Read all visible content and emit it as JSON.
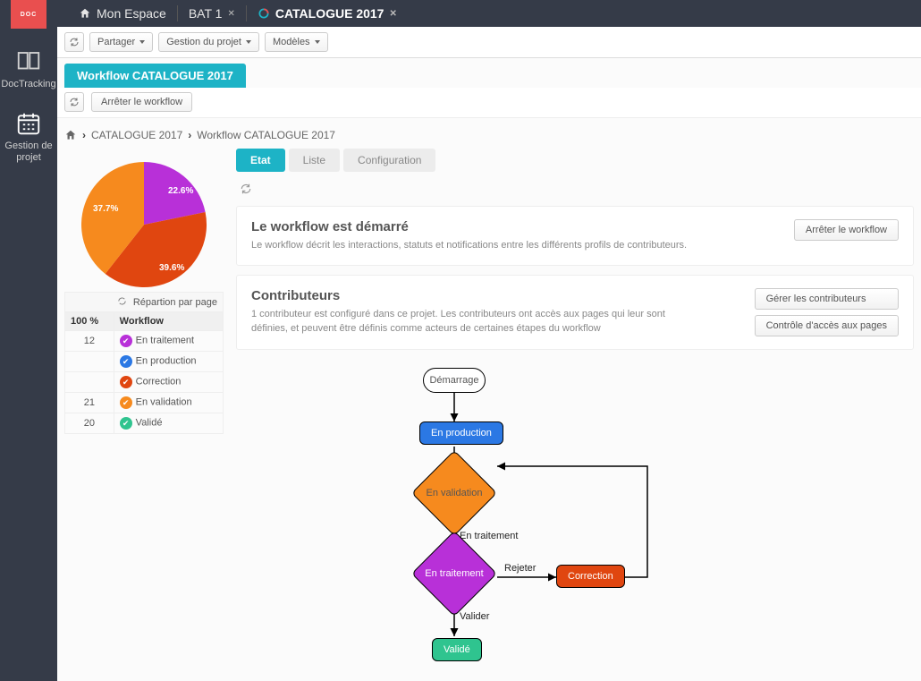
{
  "brand": "DOC\\nTRACKING",
  "rail": {
    "doctracking": "DocTracking",
    "gestion": "Gestion de projet"
  },
  "topbar": {
    "home": "Mon Espace",
    "tab1": "BAT 1",
    "tab2": "CATALOGUE 2017"
  },
  "subbar": {
    "share": "Partager",
    "project": "Gestion du projet",
    "models": "Modèles"
  },
  "workflow_tab": "Workflow CATALOGUE 2017",
  "stop_workflow": "Arrêter le workflow",
  "breadcrumb": {
    "a": "CATALOGUE 2017",
    "b": "Workflow CATALOGUE 2017"
  },
  "chart_data": {
    "type": "pie",
    "title": "",
    "slices": [
      {
        "label": "37.7%",
        "value": 37.7,
        "color": "#f68a1e"
      },
      {
        "label": "22.6%",
        "value": 22.6,
        "color": "#b830d8"
      },
      {
        "label": "39.6%",
        "value": 39.6,
        "color": "#e04610"
      }
    ]
  },
  "side_table": {
    "h1": "100 %",
    "h2": "Workflow",
    "repartition": "Répartion par page",
    "rows": [
      {
        "count": "12",
        "color": "#b830d8",
        "label": "En traitement"
      },
      {
        "count": "",
        "color": "#2b78e4",
        "label": "En production"
      },
      {
        "count": "",
        "color": "#e04610",
        "label": "Correction"
      },
      {
        "count": "21",
        "color": "#f68a1e",
        "label": "En validation"
      },
      {
        "count": "20",
        "color": "#2fc48f",
        "label": "Validé"
      }
    ]
  },
  "tabs": {
    "etat": "Etat",
    "liste": "Liste",
    "config": "Configuration"
  },
  "card1": {
    "title": "Le workflow est démarré",
    "text": "Le workflow décrit les interactions, statuts et notifications entre les différents profils de contributeurs.",
    "btn": "Arrêter le workflow"
  },
  "card2": {
    "title": "Contributeurs",
    "text": "1 contributeur est configuré dans ce projet. Les contributeurs ont accès aux pages qui leur sont définies, et peuvent être définis comme acteurs de certaines étapes du workflow",
    "btn1": "Gérer les contributeurs",
    "btn2": "Contrôle d'accès aux pages"
  },
  "diagram": {
    "start": "Démarrage",
    "prod": "En production",
    "valid": "En validation",
    "trait": "En traitement",
    "reject": "Rejeter",
    "corr": "Correction",
    "valider": "Valider",
    "done": "Validé",
    "edge_trait": "En traitement"
  }
}
